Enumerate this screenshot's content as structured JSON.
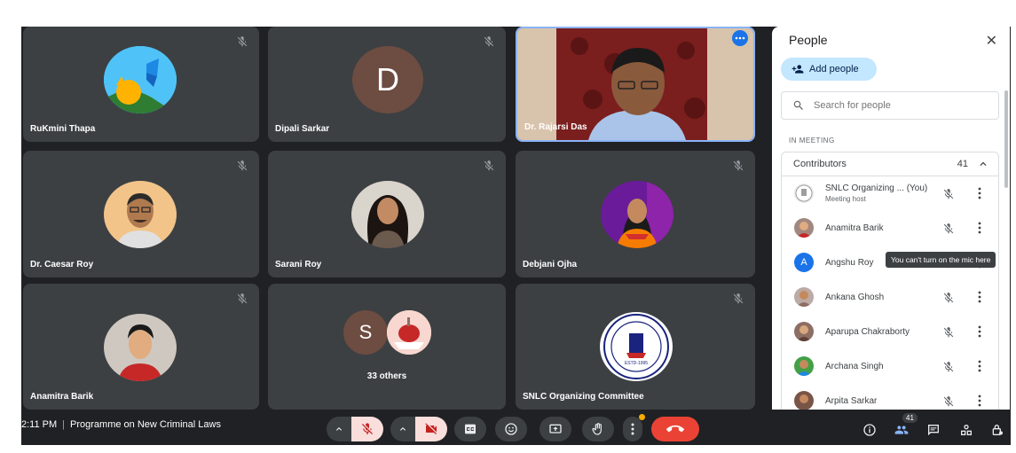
{
  "tiles": [
    {
      "name": "RuKmini Thapa"
    },
    {
      "name": "Dipali Sarkar",
      "initial": "D"
    },
    {
      "name": "Dr. Rajarsi Das"
    },
    {
      "name": "Dr. Caesar Roy"
    },
    {
      "name": "Sarani Roy"
    },
    {
      "name": "Debjani Ojha"
    },
    {
      "name": "Anamitra Barik"
    },
    {
      "name": "33 others",
      "initial": "S"
    },
    {
      "name": "SNLC Organizing Committee",
      "logo_text": "ESTD-1995"
    }
  ],
  "panel": {
    "title": "People",
    "add_people": "Add people",
    "search_placeholder": "Search for people",
    "section": "IN MEETING",
    "group": "Contributors",
    "group_count": "41",
    "people": [
      {
        "name": "SNLC Organizing ...  (You)",
        "sub": "Meeting host"
      },
      {
        "name": "Anamitra Barik"
      },
      {
        "name": "Angshu Roy",
        "initial": "A"
      },
      {
        "name": "Ankana Ghosh"
      },
      {
        "name": "Aparupa Chakraborty"
      },
      {
        "name": "Archana Singh"
      },
      {
        "name": "Arpita Sarkar"
      }
    ],
    "tooltip": "You can't turn on the mic here"
  },
  "bar": {
    "time": "2:11 PM",
    "meeting": "Programme on New Criminal Laws",
    "people_badge": "41"
  },
  "colors": {
    "accent": "#c2e7ff",
    "end_call": "#ea4335",
    "tile_bg": "#3c4043",
    "highlight": "#8ab4f8"
  }
}
